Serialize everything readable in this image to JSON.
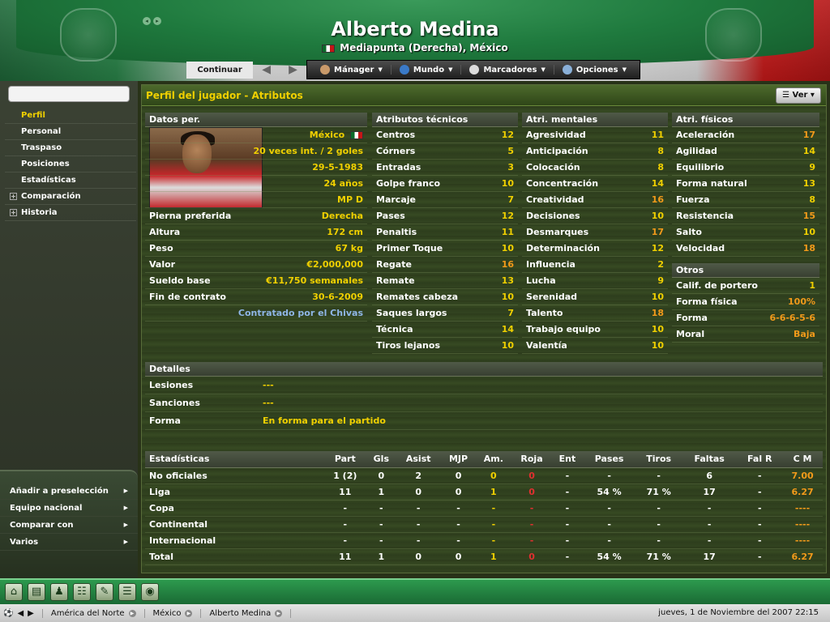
{
  "header": {
    "player_name": "Alberto Medina",
    "subtitle": "Mediapunta (Derecha), México",
    "nav_back": "◂",
    "nav_forward": "▸"
  },
  "menubar": {
    "continue_label": "Continuar",
    "items": [
      {
        "label": "Mánager",
        "icon": "manager-icon"
      },
      {
        "label": "Mundo",
        "icon": "globe-icon"
      },
      {
        "label": "Marcadores",
        "icon": "bookmark-icon"
      },
      {
        "label": "Opciones",
        "icon": "gears-icon"
      }
    ]
  },
  "sidebar": {
    "items": [
      {
        "label": "Perfil",
        "active": true
      },
      {
        "label": "Personal"
      },
      {
        "label": "Traspaso"
      },
      {
        "label": "Posiciones"
      },
      {
        "label": "Estadísticas"
      },
      {
        "label": "Comparación",
        "expandable": true
      },
      {
        "label": "Historia",
        "expandable": true
      }
    ],
    "bottom_items": [
      "Añadir a preselección",
      "Equipo nacional",
      "Comparar con",
      "Varios"
    ]
  },
  "panel": {
    "title": "Perfil del jugador - Atributos",
    "view_button": "Ver"
  },
  "personal": {
    "header": "Datos per.",
    "photo_rows": [
      {
        "value": "México"
      },
      {
        "value": "20 veces int. / 2 goles"
      },
      {
        "value": "29-5-1983"
      },
      {
        "value": "24 años"
      },
      {
        "value": "MP D"
      }
    ],
    "rows": [
      {
        "label": "Pierna preferida",
        "value": "Derecha"
      },
      {
        "label": "Altura",
        "value": "172 cm"
      },
      {
        "label": "Peso",
        "value": "67 kg"
      },
      {
        "label": "Valor",
        "value": "€2,000,000"
      },
      {
        "label": "Sueldo base",
        "value": "€11,750 semanales"
      },
      {
        "label": "Fin de contrato",
        "value": "30-6-2009"
      },
      {
        "label": "",
        "value": "Contratado por el Chivas"
      }
    ]
  },
  "technical": {
    "header": "Atributos técnicos",
    "rows": [
      {
        "label": "Centros",
        "value": "12"
      },
      {
        "label": "Córners",
        "value": "5"
      },
      {
        "label": "Entradas",
        "value": "3"
      },
      {
        "label": "Golpe franco",
        "value": "10"
      },
      {
        "label": "Marcaje",
        "value": "7"
      },
      {
        "label": "Pases",
        "value": "12"
      },
      {
        "label": "Penaltis",
        "value": "11"
      },
      {
        "label": "Primer Toque",
        "value": "10"
      },
      {
        "label": "Regate",
        "value": "16"
      },
      {
        "label": "Remate",
        "value": "13"
      },
      {
        "label": "Remates cabeza",
        "value": "10"
      },
      {
        "label": "Saques largos",
        "value": "7"
      },
      {
        "label": "Técnica",
        "value": "14"
      },
      {
        "label": "Tiros lejanos",
        "value": "10"
      }
    ]
  },
  "mental": {
    "header": "Atri. mentales",
    "rows": [
      {
        "label": "Agresividad",
        "value": "11"
      },
      {
        "label": "Anticipación",
        "value": "8"
      },
      {
        "label": "Colocación",
        "value": "8"
      },
      {
        "label": "Concentración",
        "value": "14"
      },
      {
        "label": "Creatividad",
        "value": "16"
      },
      {
        "label": "Decisiones",
        "value": "10"
      },
      {
        "label": "Desmarques",
        "value": "17"
      },
      {
        "label": "Determinación",
        "value": "12"
      },
      {
        "label": "Influencia",
        "value": "2"
      },
      {
        "label": "Lucha",
        "value": "9"
      },
      {
        "label": "Serenidad",
        "value": "10"
      },
      {
        "label": "Talento",
        "value": "18"
      },
      {
        "label": "Trabajo equipo",
        "value": "10"
      },
      {
        "label": "Valentía",
        "value": "10"
      }
    ]
  },
  "physical": {
    "header": "Atri. físicos",
    "rows": [
      {
        "label": "Aceleración",
        "value": "17"
      },
      {
        "label": "Agilidad",
        "value": "14"
      },
      {
        "label": "Equilibrio",
        "value": "9"
      },
      {
        "label": "Forma natural",
        "value": "13"
      },
      {
        "label": "Fuerza",
        "value": "8"
      },
      {
        "label": "Resistencia",
        "value": "15"
      },
      {
        "label": "Salto",
        "value": "10"
      },
      {
        "label": "Velocidad",
        "value": "18"
      }
    ]
  },
  "otros": {
    "header": "Otros",
    "rows": [
      {
        "label": "Calif. de portero",
        "value": "1"
      },
      {
        "label": "Forma física",
        "value": "100%"
      },
      {
        "label": "Forma",
        "value": "6-6-6-5-6"
      },
      {
        "label": "Moral",
        "value": "Baja"
      }
    ]
  },
  "detalles": {
    "header": "Detalles",
    "rows": [
      {
        "label": "Lesiones",
        "value": "---"
      },
      {
        "label": "Sanciones",
        "value": "---"
      },
      {
        "label": "Forma",
        "value": "En forma para el partido"
      }
    ]
  },
  "stats": {
    "headers": [
      "Estadísticas",
      "Part",
      "Gls",
      "Asist",
      "MJP",
      "Am.",
      "Roja",
      "Ent",
      "Pases",
      "Tiros",
      "Faltas",
      "Fal R",
      "C M"
    ],
    "rows": [
      [
        "No oficiales",
        "1 (2)",
        "0",
        "2",
        "0",
        "0",
        "0",
        "-",
        "-",
        "-",
        "6",
        "-",
        "7.00"
      ],
      [
        "Liga",
        "11",
        "1",
        "0",
        "0",
        "1",
        "0",
        "-",
        "54 %",
        "71 %",
        "17",
        "-",
        "6.27"
      ],
      [
        "Copa",
        "-",
        "-",
        "-",
        "-",
        "-",
        "-",
        "-",
        "-",
        "-",
        "-",
        "-",
        "----"
      ],
      [
        "Continental",
        "-",
        "-",
        "-",
        "-",
        "-",
        "-",
        "-",
        "-",
        "-",
        "-",
        "-",
        "----"
      ],
      [
        "Internacional",
        "-",
        "-",
        "-",
        "-",
        "-",
        "-",
        "-",
        "-",
        "-",
        "-",
        "-",
        "----"
      ],
      [
        "Total",
        "11",
        "1",
        "0",
        "0",
        "1",
        "0",
        "-",
        "54 %",
        "71 %",
        "17",
        "-",
        "6.27"
      ]
    ]
  },
  "bottom_icons": [
    "home-icon",
    "notebook-icon",
    "team-icon",
    "tactics-icon",
    "clipboard-icon",
    "report-icon",
    "globe-icon"
  ],
  "statusbar": {
    "crumbs": [
      "América del Norte",
      "México",
      "Alberto Medina"
    ],
    "date": "jueves, 1 de Noviembre del 2007 22:15"
  },
  "colors": {
    "accent": "#f0d000",
    "highlight": "#f29a1a",
    "link": "#8fb6e6",
    "negative": "#e03030",
    "header_green": "#1f7a3e"
  }
}
